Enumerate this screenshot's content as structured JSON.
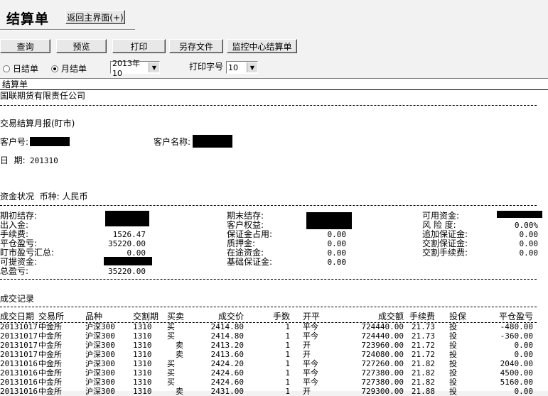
{
  "header": {
    "title": "结算单",
    "back_button": "返回主界面(+)"
  },
  "toolbar": {
    "query": "查询",
    "preview": "预览",
    "print": "打印",
    "save_as": "另存文件",
    "monitor": "监控中心结算单"
  },
  "options": {
    "daily": "日结单",
    "monthly": "月结单",
    "selected": "monthly",
    "period": "2013年10",
    "font_label": "打印字号",
    "font_size": "10"
  },
  "doc": {
    "panel_title": "结算单",
    "company": "国联期货有限责任公司",
    "report_title": "交易结算月报(盯市)",
    "client_no_label": "客户号:",
    "client_name_label": "客户名称:",
    "date_label": "日  期:",
    "date_value": "201310",
    "funds_title": "资金状况  币种: 人民币",
    "funds": {
      "c1": [
        {
          "label": "期初结存:",
          "value": ""
        },
        {
          "label": "出入金:",
          "value": ""
        },
        {
          "label": "手续费:",
          "value": "1526.47"
        },
        {
          "label": "平仓盈亏:",
          "value": "35220.00"
        },
        {
          "label": "盯市盈亏汇总:",
          "value": "0.00"
        },
        {
          "label": "可提资金:",
          "value": ""
        },
        {
          "label": "总盈亏:",
          "value": "35220.00"
        }
      ],
      "c2": [
        {
          "label": "期末结存:",
          "value": ""
        },
        {
          "label": "客户权益:",
          "value": ""
        },
        {
          "label": "保证金占用:",
          "value": "0.00"
        },
        {
          "label": "质押金:",
          "value": "0.00"
        },
        {
          "label": "在途资金:",
          "value": "0.00"
        },
        {
          "label": "基础保证金:",
          "value": "0.00"
        }
      ],
      "c3": [
        {
          "label": "可用资金:",
          "value": ""
        },
        {
          "label": "风 险 度:",
          "value": "0.00%"
        },
        {
          "label": "追加保证金:",
          "value": "0.00"
        },
        {
          "label": "交割保证金:",
          "value": "0.00"
        },
        {
          "label": "交割手续费:",
          "value": "0.00"
        }
      ]
    },
    "trades_title": "成交记录",
    "trade_headers": [
      "成交日期",
      "交易所",
      "品种",
      "交割期",
      "买卖",
      "成交价",
      "手数",
      "开平",
      "成交额",
      "手续费",
      "投保",
      "平仓盈亏"
    ],
    "trades": [
      [
        "20131017",
        "中金所",
        "沪深300",
        "1310",
        "买",
        "2414.80",
        "1",
        "平今",
        "724440.00",
        "21.73",
        "投",
        "-480.00"
      ],
      [
        "20131017",
        "中金所",
        "沪深300",
        "1310",
        "买",
        "2414.80",
        "1",
        "平今",
        "724440.00",
        "21.73",
        "投",
        "-360.00"
      ],
      [
        "20131017",
        "中金所",
        "沪深300",
        "1310",
        "卖",
        "2413.20",
        "1",
        "开",
        "723960.00",
        "21.72",
        "投",
        "0.00"
      ],
      [
        "20131017",
        "中金所",
        "沪深300",
        "1310",
        "卖",
        "2413.60",
        "1",
        "开",
        "724080.00",
        "21.72",
        "投",
        "0.00"
      ],
      [
        "20131016",
        "中金所",
        "沪深300",
        "1310",
        "买",
        "2424.20",
        "1",
        "平今",
        "727260.00",
        "21.82",
        "投",
        "2040.00"
      ],
      [
        "20131016",
        "中金所",
        "沪深300",
        "1310",
        "买",
        "2424.60",
        "1",
        "平今",
        "727380.00",
        "21.82",
        "投",
        "4500.00"
      ],
      [
        "20131016",
        "中金所",
        "沪深300",
        "1310",
        "买",
        "2424.60",
        "1",
        "平今",
        "727380.00",
        "21.82",
        "投",
        "5160.00"
      ],
      [
        "20131016",
        "中金所",
        "沪深300",
        "1310",
        "卖",
        "2431.00",
        "1",
        "开",
        "729300.00",
        "21.88",
        "投",
        "0.00"
      ]
    ]
  }
}
